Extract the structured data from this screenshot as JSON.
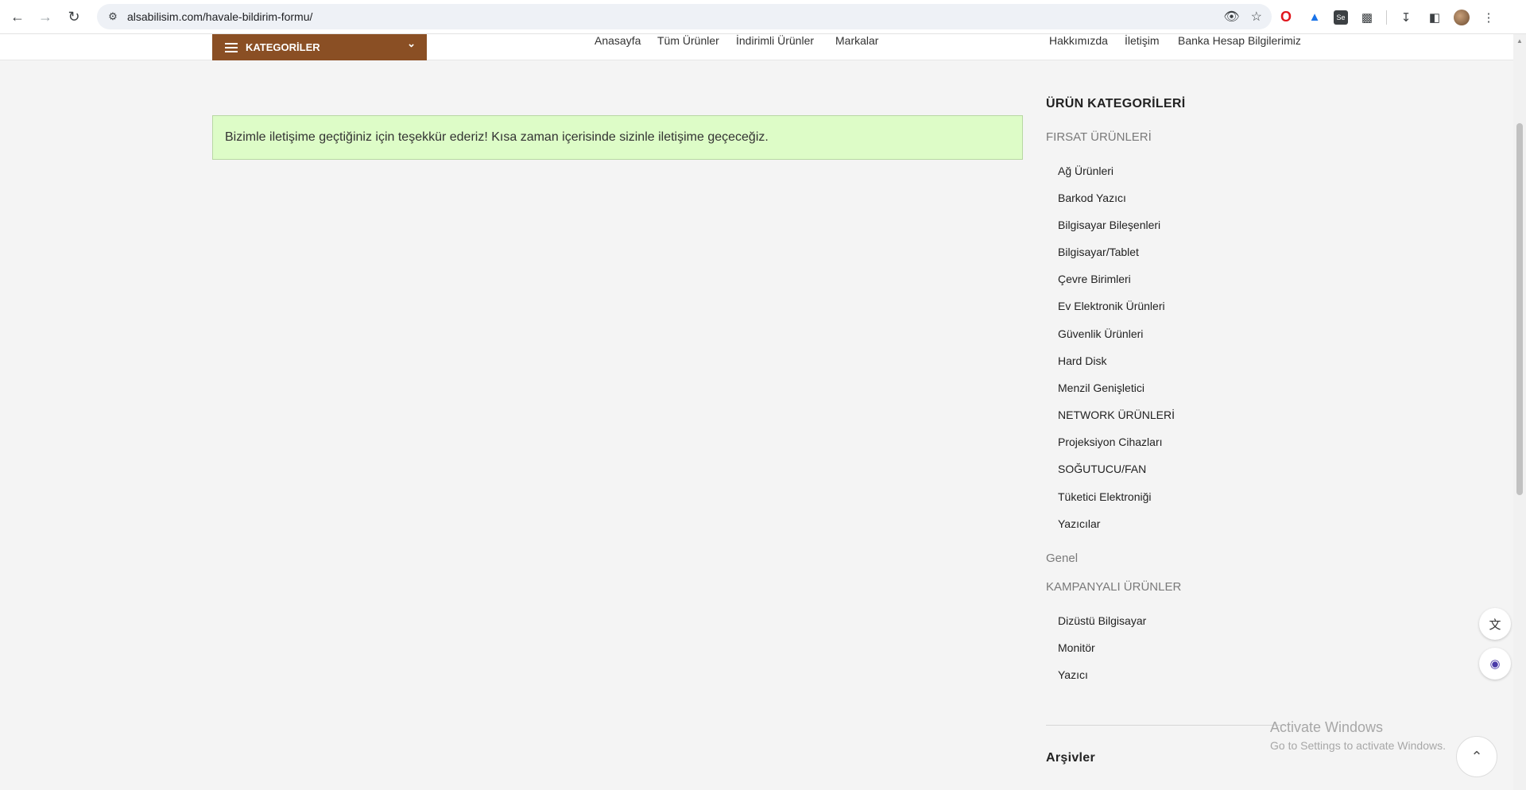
{
  "browser": {
    "url": "alsabilisim.com/havale-bildirim-formu/",
    "back_icon": "arrow-left-icon",
    "forward_icon": "arrow-right-icon",
    "reload_icon": "reload-icon"
  },
  "header": {
    "categories_label": "KATEGORİLER",
    "nav": [
      "Anasayfa",
      "Tüm Ürünler",
      "İndirimli Ürünler",
      "Markalar",
      "Hakkımızda",
      "İletişim",
      "Banka Hesap Bilgilerimiz"
    ]
  },
  "notice": {
    "text": "Bizimle iletişime geçtiğiniz için teşekkür ederiz! Kısa zaman içerisinde sizinle iletişime geçeceğiz."
  },
  "sidebar": {
    "title": "ÜRÜN KATEGORİLERİ",
    "group1": "FIRSAT ÜRÜNLERİ",
    "group1_items": [
      "Ağ Ürünleri",
      "Barkod Yazıcı",
      "Bilgisayar Bileşenleri",
      "Bilgisayar/Tablet",
      "Çevre Birimleri",
      "Ev Elektronik Ürünleri",
      "Güvenlik Ürünleri",
      "Hard Disk",
      "Menzil Genişletici",
      "NETWORK ÜRÜNLERİ",
      "Projeksiyon Cihazları",
      "SOĞUTUCU/FAN",
      "Tüketici Elektroniği",
      "Yazıcılar"
    ],
    "group2": "Genel",
    "group3": "KAMPANYALI ÜRÜNLER",
    "group3_items": [
      "Dizüstü Bilgisayar",
      "Monitör",
      "Yazıcı"
    ],
    "archives_title": "Arşivler"
  },
  "watermark": {
    "line1": "Activate Windows",
    "line2": "Go to Settings to activate Windows."
  }
}
